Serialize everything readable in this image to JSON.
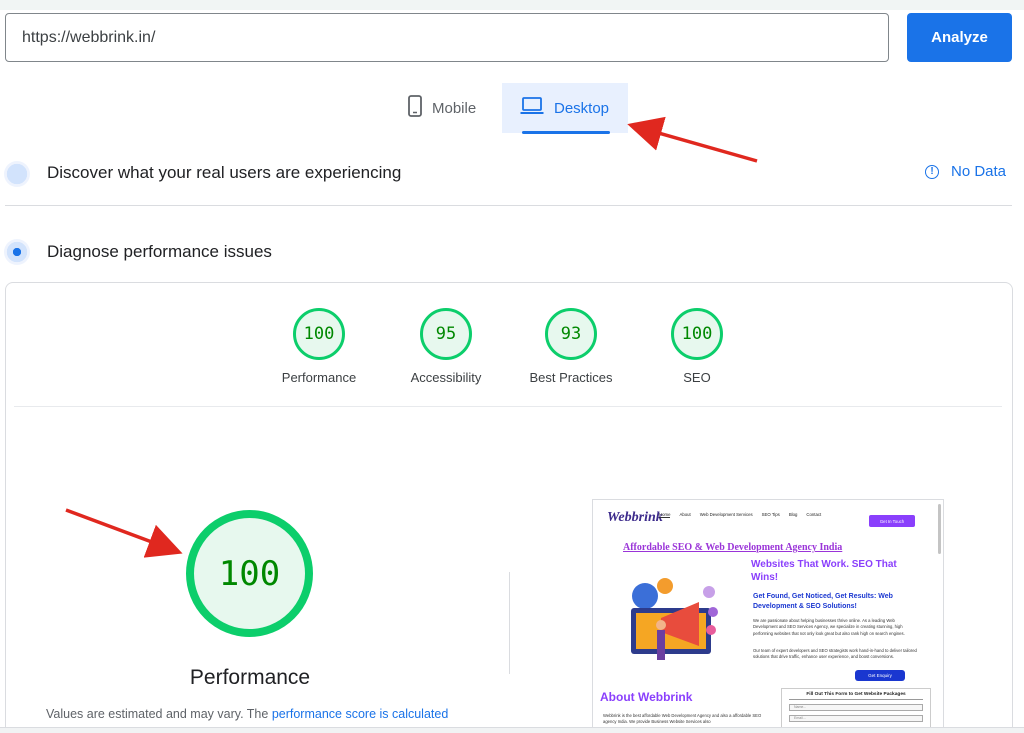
{
  "url_input": {
    "value": "https://webbrink.in/"
  },
  "analyze_label": "Analyze",
  "tabs": [
    {
      "label": "Mobile",
      "icon": "mobile-phone-icon"
    },
    {
      "label": "Desktop",
      "icon": "laptop-icon",
      "selected": true
    }
  ],
  "sections": {
    "real_users": {
      "title": "Discover what your real users are experiencing",
      "status": "No Data"
    },
    "diagnose": {
      "title": "Diagnose performance issues"
    }
  },
  "scores": [
    {
      "label": "Performance",
      "value": "100"
    },
    {
      "label": "Accessibility",
      "value": "95"
    },
    {
      "label": "Best Practices",
      "value": "93"
    },
    {
      "label": "SEO",
      "value": "100"
    }
  ],
  "main_score": {
    "value": "100",
    "label": "Performance"
  },
  "estimate": {
    "text": "Values are estimated and may vary. The ",
    "link": "performance score is calculated"
  },
  "screenshot": {
    "logo": "Webbrink",
    "nav": [
      "Home",
      "About",
      "Web Development Services",
      "SEO Tips",
      "Blog",
      "Contact"
    ],
    "cta": "Get In Touch",
    "agency": "Affordable SEO & Web Development Agency India",
    "headline": "Websites That Work. SEO That Wins!",
    "subheadline": "Get Found, Get Noticed, Get Results: Web Development & SEO Solutions!",
    "para1": "We are passionate about helping businesses thrive online. As a leading Web Development and SEO Services Agency, we specialize in creating stunning, high performing websites that not only look great but also rank high on search engines.",
    "para2": "Our team of expert developers and SEO strategists work hand-in-hand to deliver tailored solutions that drive traffic, enhance user experience, and boost conversions.",
    "enquiry": "Get Enquiry",
    "about": "About Webbrink",
    "about_text": "Webbrink is the best affordable Web Development Agency and also a affordable SEO agency India. We provide Business Website Services also",
    "form_title": "Fill Out This Form to Get Website Packages",
    "form_fields": [
      "Name...",
      "Email..."
    ]
  }
}
